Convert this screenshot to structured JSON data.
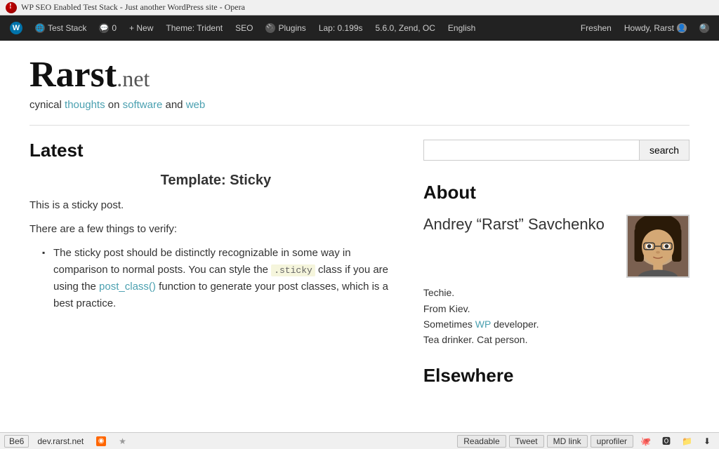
{
  "titlebar": {
    "title": "WP SEO Enabled Test Stack - Just another WordPress site - Opera",
    "favicon_label": "error-favicon"
  },
  "adminbar": {
    "wp_icon": "W",
    "items": [
      {
        "id": "test-stack",
        "label": "Test Stack",
        "icon": "globe-icon"
      },
      {
        "id": "comments",
        "label": "0",
        "icon": "comment-icon"
      },
      {
        "id": "new",
        "label": "+ New"
      },
      {
        "id": "theme",
        "label": "Theme: Trident"
      },
      {
        "id": "seo",
        "label": "SEO"
      },
      {
        "id": "plugins",
        "label": "Plugins",
        "icon": "plugin-icon"
      },
      {
        "id": "lap",
        "label": "Lap: 0.199s"
      },
      {
        "id": "version",
        "label": "5.6.0, Zend, OC"
      },
      {
        "id": "english",
        "label": "English"
      }
    ],
    "right_items": [
      {
        "id": "freshen",
        "label": "Freshen"
      },
      {
        "id": "howdy",
        "label": "Howdy, Rarst",
        "icon": "user-icon"
      },
      {
        "id": "search",
        "label": "",
        "icon": "search-icon"
      }
    ]
  },
  "site": {
    "title": "Rarst",
    "tld": ".net",
    "tagline_plain1": "cynical ",
    "tagline_link1": "thoughts",
    "tagline_plain2": " on ",
    "tagline_link2": "software",
    "tagline_plain3": " and ",
    "tagline_link3": "web"
  },
  "search": {
    "placeholder": "",
    "button_label": "search"
  },
  "content": {
    "latest_heading": "Latest",
    "post": {
      "title": "Template: Sticky",
      "intro1": "This is a sticky post.",
      "intro2": "There are a few things to verify:",
      "list_item1_prefix": "The sticky post should be distinctly recognizable in some way in comparison to normal posts. You can style the ",
      "list_item1_code": ".sticky",
      "list_item1_mid": " class if you are using the ",
      "list_item1_link": "post_class()",
      "list_item1_suffix": " function to generate your post classes, which is a best practice."
    }
  },
  "sidebar": {
    "about_heading": "About",
    "about_name": "Andrey “Rarst” Savchenko",
    "about_bio": "Techie.\nFrom Kiev.\nSometimes WP developer.\nTea drinker. Cat person.",
    "wp_link": "WP",
    "elsewhere_heading": "Elsewhere",
    "avatar_alt": "Andrey Rarst Savchenko avatar"
  },
  "statusbar": {
    "site_label": "Be6",
    "url": "dev.rarst.net",
    "rss_icon": "rss-icon",
    "star_icon": "star-icon",
    "right_items": [
      {
        "id": "readable",
        "label": "Readable"
      },
      {
        "id": "tweet",
        "label": "Tweet"
      },
      {
        "id": "md-link",
        "label": "MD link"
      },
      {
        "id": "uprofiler",
        "label": "uprofiler"
      }
    ],
    "icons": [
      "github-icon",
      "opera-icon",
      "folder-icon",
      "download-icon"
    ]
  }
}
